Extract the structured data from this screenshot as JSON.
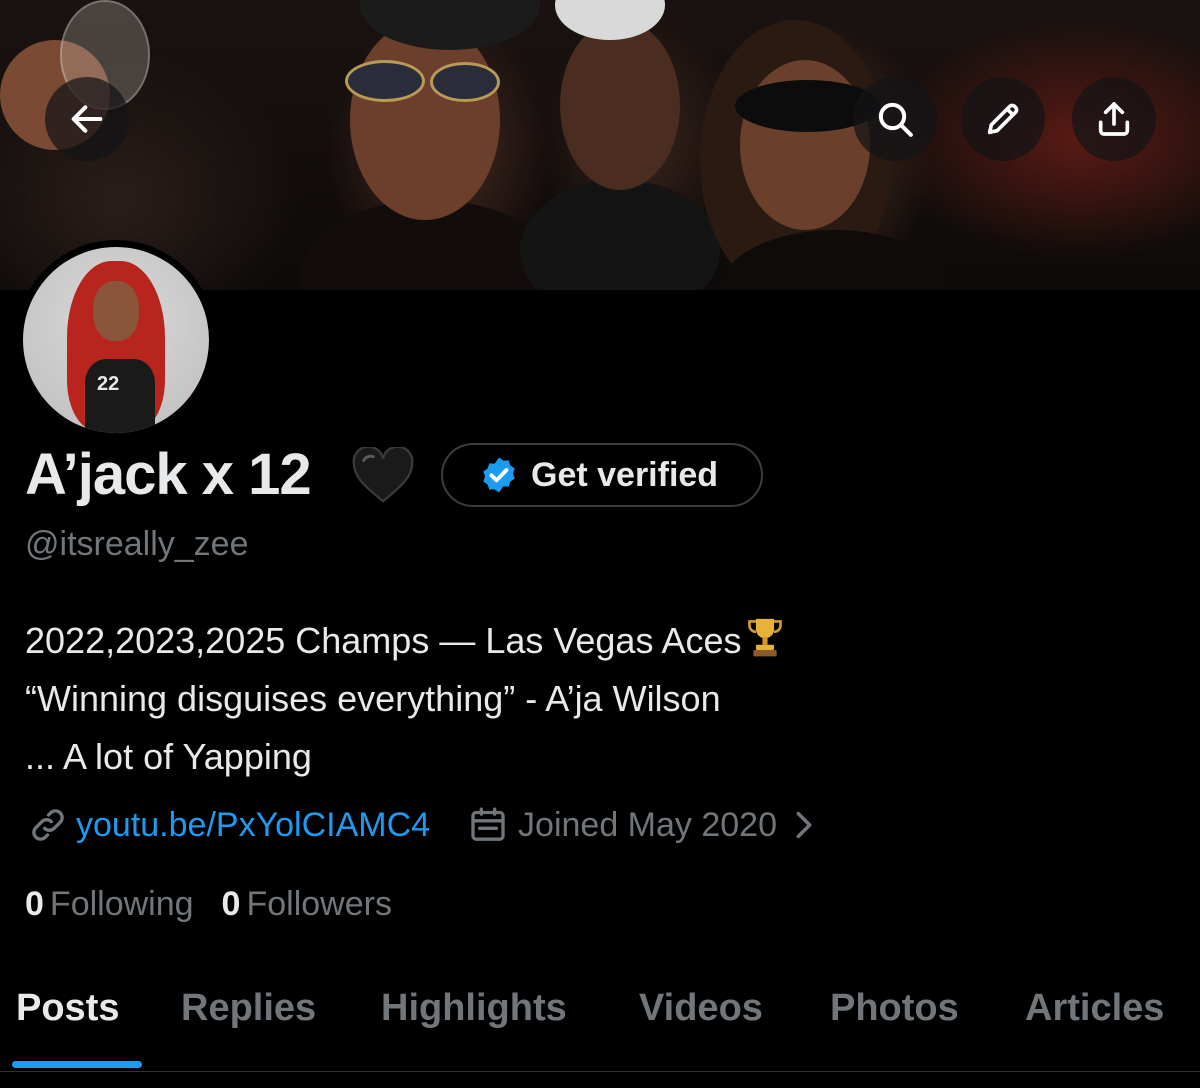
{
  "header": {
    "back_icon": "arrow-left-icon",
    "actions": [
      "search-icon",
      "pencil-icon",
      "share-icon"
    ]
  },
  "profile": {
    "display_name": "A’jack x 12",
    "name_emoji": "black-heart",
    "verify_label": "Get verified",
    "handle": "@itsreally_zee",
    "avatar_jersey_number": "22",
    "bio": {
      "line1": "2022,2023,2025 Champs — Las Vegas Aces",
      "line2": " “Winning disguises everything” - A’ja Wilson",
      "line3": "... A lot of Yapping"
    },
    "link": "youtu.be/PxYolCIAMC4",
    "joined": "Joined May 2020",
    "following_count": "0",
    "following_label": "Following",
    "followers_count": "0",
    "followers_label": "Followers"
  },
  "tabs": [
    {
      "label": "Posts",
      "active": true
    },
    {
      "label": "Replies",
      "active": false
    },
    {
      "label": "Highlights",
      "active": false
    },
    {
      "label": "Videos",
      "active": false
    },
    {
      "label": "Photos",
      "active": false
    },
    {
      "label": "Articles",
      "active": false
    }
  ],
  "colors": {
    "accent": "#1d9bf0",
    "text_primary": "#e7e9ea",
    "text_secondary": "#71767b",
    "background": "#000000"
  }
}
